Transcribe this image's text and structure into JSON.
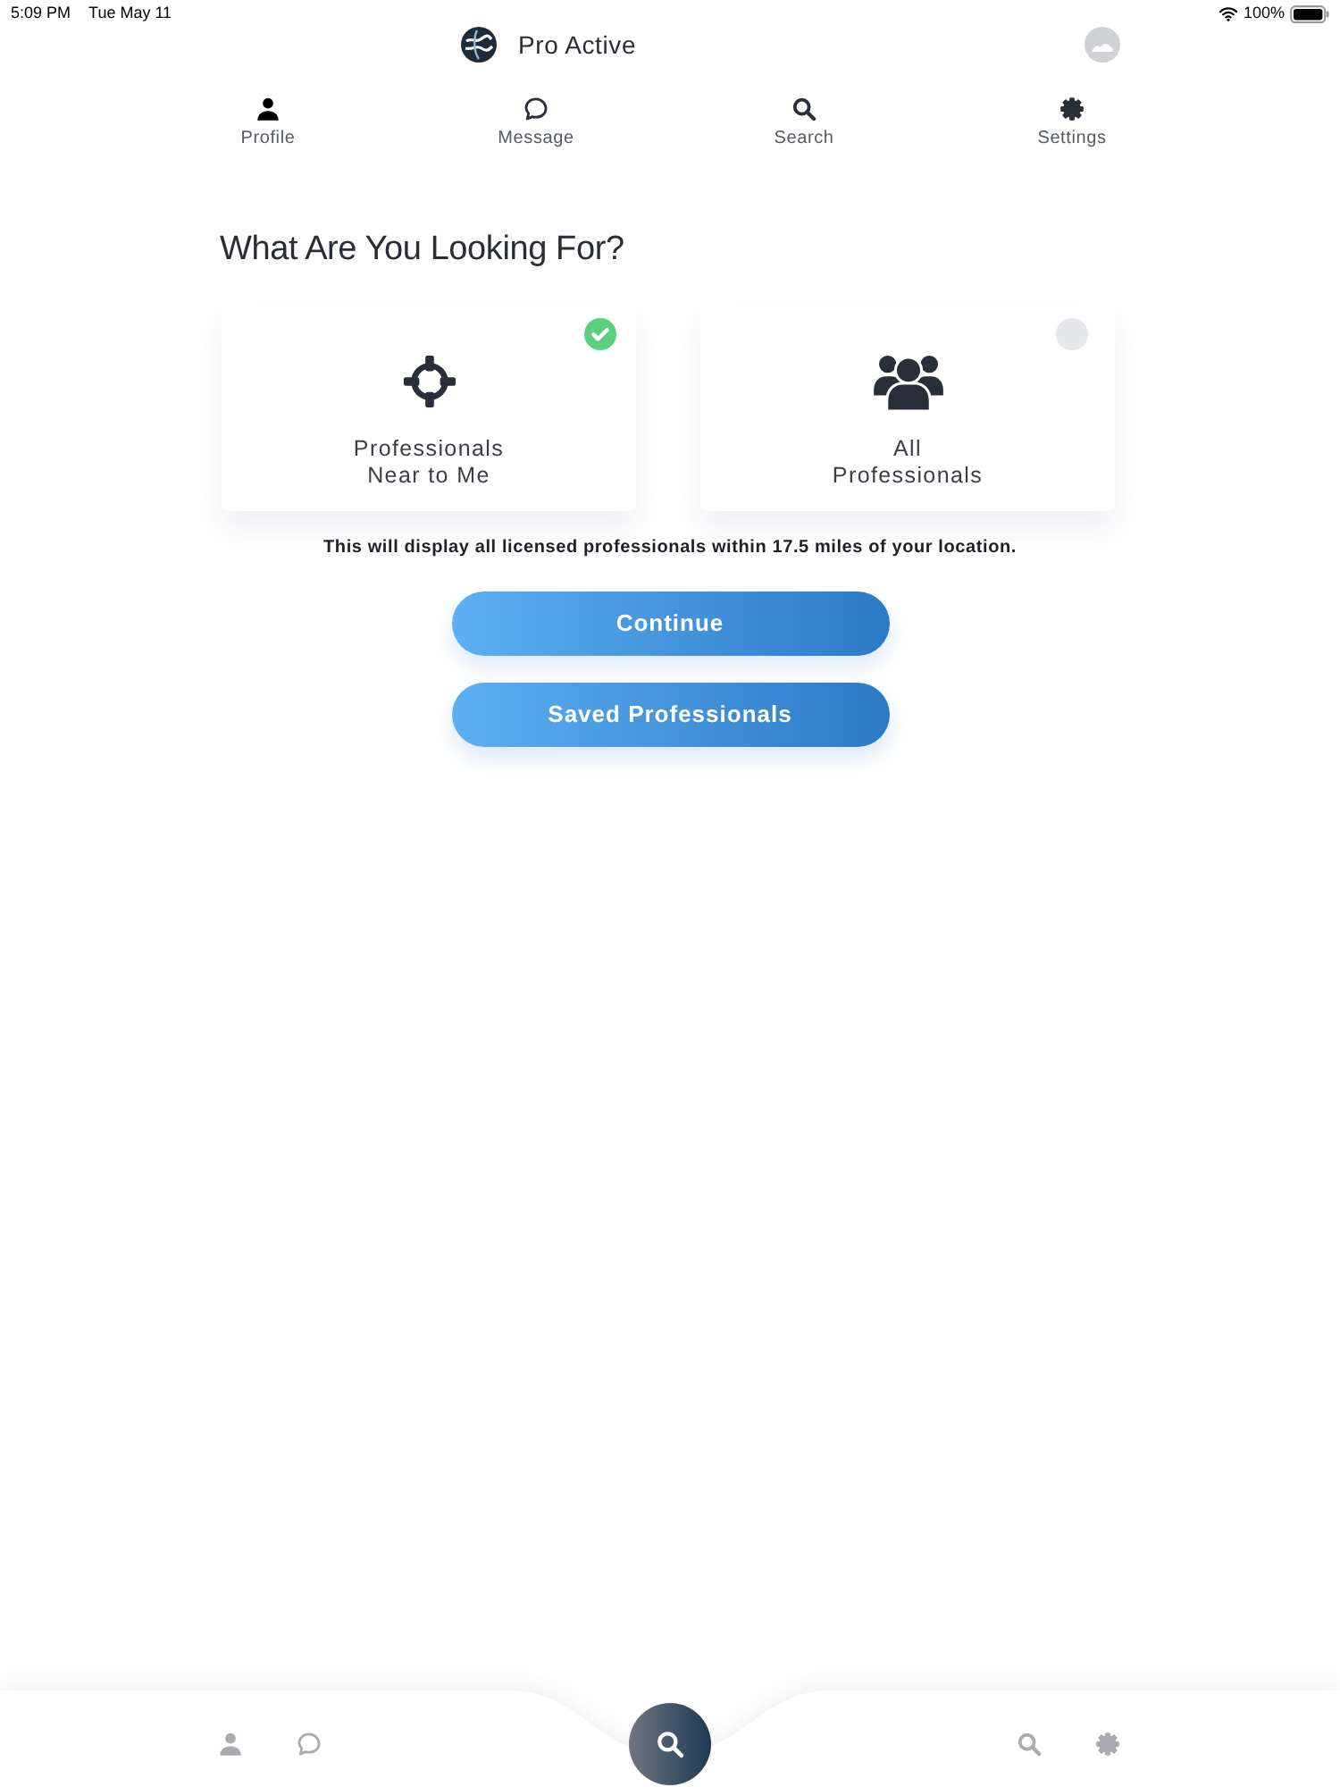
{
  "status_bar": {
    "time": "5:09 PM",
    "date": "Tue May 11",
    "battery": "100%"
  },
  "header": {
    "title": "Pro Active"
  },
  "nav_tabs": [
    {
      "label": "Profile"
    },
    {
      "label": "Message"
    },
    {
      "label": "Search"
    },
    {
      "label": "Settings"
    }
  ],
  "heading": "What Are You Looking For?",
  "options": [
    {
      "label": "Professionals\nNear to Me",
      "selected": true
    },
    {
      "label": "All\nProfessionals",
      "selected": false
    }
  ],
  "note": "This will display all licensed professionals within 17.5 miles of your location.",
  "buttons": [
    "Continue",
    "Saved Professionals"
  ]
}
